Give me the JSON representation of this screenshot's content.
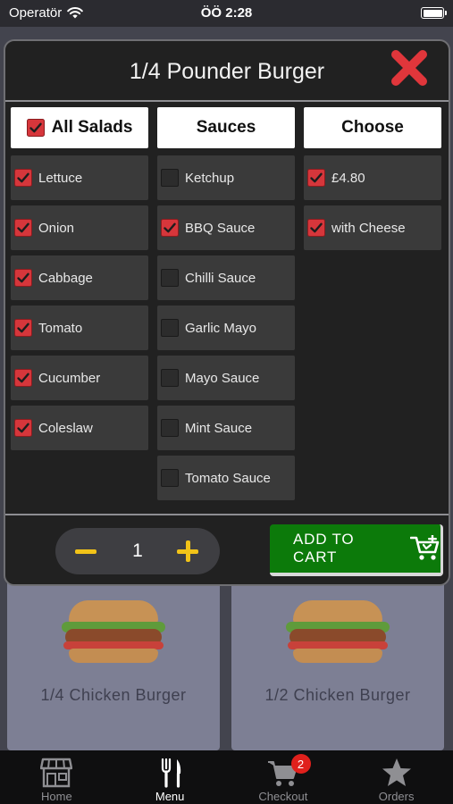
{
  "status_bar": {
    "carrier": "Operatör",
    "time": "ÖÖ 2:28"
  },
  "background_products": [
    {
      "name": "1/4 Chicken Burger"
    },
    {
      "name": "1/2 Chicken Burger"
    }
  ],
  "modal": {
    "title": "1/4 Pounder Burger",
    "columns": {
      "salads": {
        "header": "All Salads",
        "header_checked": true,
        "options": [
          {
            "label": "Lettuce",
            "checked": true
          },
          {
            "label": "Onion",
            "checked": true
          },
          {
            "label": "Cabbage",
            "checked": true
          },
          {
            "label": "Tomato",
            "checked": true
          },
          {
            "label": "Cucumber",
            "checked": true
          },
          {
            "label": "Coleslaw",
            "checked": true
          }
        ]
      },
      "sauces": {
        "header": "Sauces",
        "options": [
          {
            "label": "Ketchup",
            "checked": false
          },
          {
            "label": "BBQ Sauce",
            "checked": true
          },
          {
            "label": "Chilli Sauce",
            "checked": false
          },
          {
            "label": "Garlic Mayo",
            "checked": false
          },
          {
            "label": "Mayo Sauce",
            "checked": false
          },
          {
            "label": "Mint Sauce",
            "checked": false
          },
          {
            "label": "Tomato Sauce",
            "checked": false
          }
        ]
      },
      "choose": {
        "header": "Choose",
        "options": [
          {
            "label": "£4.80",
            "checked": true
          },
          {
            "label": "with Cheese",
            "checked": true
          }
        ]
      }
    },
    "quantity": "1",
    "add_to_cart_label": "ADD TO CART"
  },
  "tab_bar": {
    "tabs": [
      {
        "label": "Home",
        "icon": "store-icon"
      },
      {
        "label": "Menu",
        "icon": "fork-knife-icon",
        "active": true
      },
      {
        "label": "Checkout",
        "icon": "cart-icon",
        "badge": "2"
      },
      {
        "label": "Orders",
        "icon": "star-icon"
      }
    ]
  },
  "colors": {
    "checkbox_checked": "#d6363b",
    "accent_yellow": "#f2c318",
    "add_to_cart_green": "#0c7a0a",
    "close_red": "#e0363b",
    "badge_red": "#e0201c"
  }
}
